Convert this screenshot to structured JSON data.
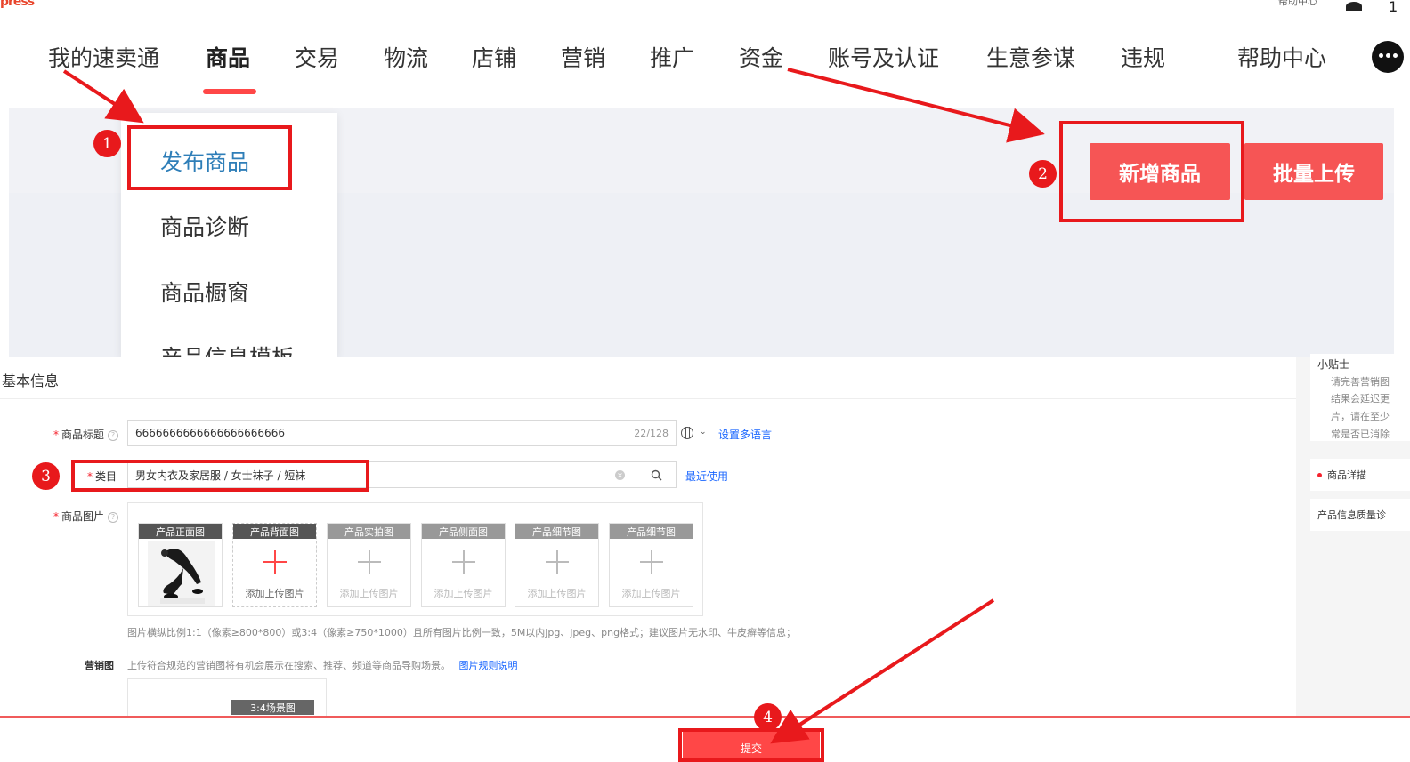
{
  "top_cut": {
    "logo": "press",
    "items": [
      "帮助中心"
    ],
    "corner_num": "1"
  },
  "nav": {
    "items": [
      "我的速卖通",
      "商品",
      "交易",
      "物流",
      "店铺",
      "营销",
      "推广",
      "资金",
      "账号及认证",
      "生意参谋",
      "违规",
      "帮助中心"
    ],
    "active": "商品"
  },
  "dropdown": {
    "items": [
      "发布商品",
      "商品诊断",
      "商品橱窗",
      "产品信息模板"
    ]
  },
  "action_buttons": {
    "new_product": "新增商品",
    "batch_upload": "批量上传"
  },
  "form": {
    "section_title": "基本信息",
    "title_label": "商品标题",
    "title_value": "6666666666666666666666",
    "title_count": "22/128",
    "multi_lang_link": "设置多语言",
    "category_label": "类目",
    "category_value": "男女内衣及家居服 / 女士袜子 / 短袜",
    "recent_link": "最近使用",
    "images_label": "商品图片",
    "image_slots": [
      {
        "header": "产品正面图",
        "add_text": "",
        "state": "filled"
      },
      {
        "header": "产品背面图",
        "add_text": "添加上传图片",
        "state": "active"
      },
      {
        "header": "产品实拍图",
        "add_text": "添加上传图片",
        "state": "disabled"
      },
      {
        "header": "产品侧面图",
        "add_text": "添加上传图片",
        "state": "disabled"
      },
      {
        "header": "产品细节图",
        "add_text": "添加上传图片",
        "state": "disabled"
      },
      {
        "header": "产品细节图",
        "add_text": "添加上传图片",
        "state": "disabled"
      }
    ],
    "image_hint": "图片横纵比例1:1（像素≥800*800）或3:4（像素≥750*1000）且所有图片比例一致，5M以内jpg、jpeg、png格式；建议图片无水印、牛皮癣等信息；",
    "marketing_label": "营销图",
    "marketing_hint": "上传符合规范的营销图将有机会展示在搜索、推荐、频道等商品导购场景。",
    "marketing_link": "图片规则说明",
    "marketing_tag": "3:4场景图",
    "submit": "提交"
  },
  "sidebar": {
    "tip_title": "小贴士",
    "tip_lines": [
      "请完善营销图",
      "结果会延迟更",
      "片，请在至少",
      "常是否已消除"
    ],
    "detail_item": "商品详描",
    "quality_item": "产品信息质量诊"
  },
  "badges": [
    "1",
    "2",
    "3",
    "4"
  ],
  "colors": {
    "accent": "#ff4747",
    "button": "#f65555",
    "highlight_frame": "#e8191c",
    "link": "#1a66ff",
    "dropdown_highlight": "#2e7eb8"
  }
}
